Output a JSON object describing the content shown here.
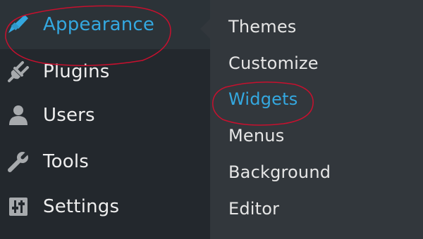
{
  "admin_menu": {
    "items": [
      {
        "label": "Appearance",
        "icon": "paintbrush-icon",
        "current": true
      },
      {
        "label": "Plugins",
        "icon": "plugin-icon",
        "current": false
      },
      {
        "label": "Users",
        "icon": "user-icon",
        "current": false
      },
      {
        "label": "Tools",
        "icon": "wrench-icon",
        "current": false
      },
      {
        "label": "Settings",
        "icon": "settings-sliders-icon",
        "current": false
      }
    ]
  },
  "submenu": {
    "items": [
      {
        "label": "Themes"
      },
      {
        "label": "Customize"
      },
      {
        "label": "Widgets",
        "highlighted": true
      },
      {
        "label": "Menus"
      },
      {
        "label": "Background"
      },
      {
        "label": "Editor"
      }
    ]
  },
  "colors": {
    "menu_background": "#23282d",
    "submenu_background": "#32373c",
    "active_text": "#34a8e0",
    "text": "#eeeeee",
    "annotation": "#c8102e"
  }
}
